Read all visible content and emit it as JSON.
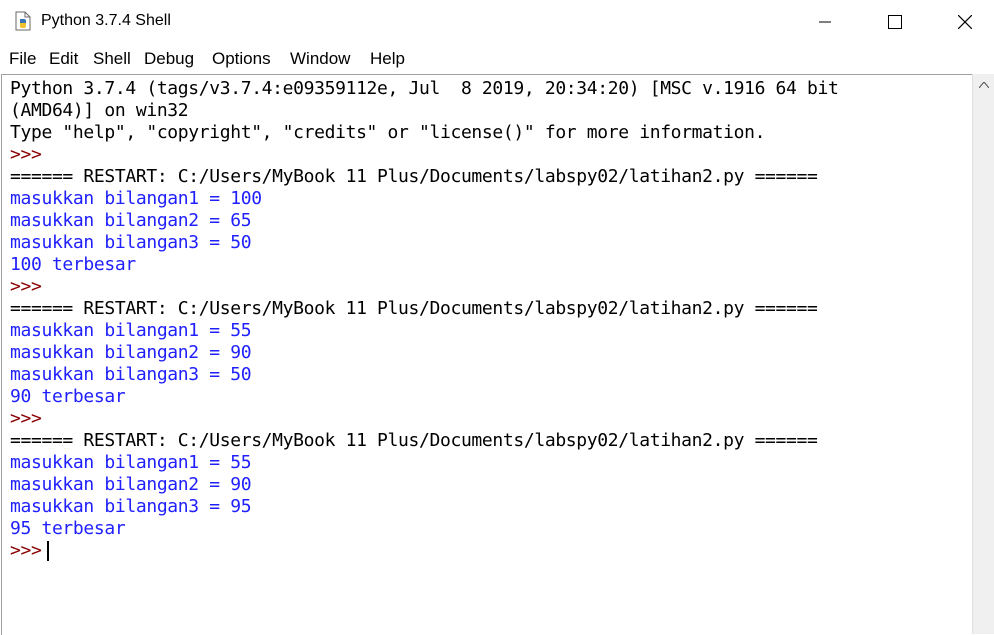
{
  "window": {
    "title": "Python 3.7.4 Shell"
  },
  "menu": [
    "File",
    "Edit",
    "Shell",
    "Debug",
    "Options",
    "Window",
    "Help"
  ],
  "shell": {
    "lines": [
      {
        "kind": "stdout",
        "text": "Python 3.7.4 (tags/v3.7.4:e09359112e, Jul  8 2019, 20:34:20) [MSC v.1916 64 bit"
      },
      {
        "kind": "stdout",
        "text": "(AMD64)] on win32"
      },
      {
        "kind": "stdout",
        "text": "Type \"help\", \"copyright\", \"credits\" or \"license()\" for more information."
      },
      {
        "kind": "prompt",
        "text": ">>>"
      },
      {
        "kind": "restart",
        "text": "====== RESTART: C:/Users/MyBook 11 Plus/Documents/labspy02/latihan2.py ======"
      },
      {
        "kind": "output",
        "text": "masukkan bilangan1 = 100"
      },
      {
        "kind": "output",
        "text": "masukkan bilangan2 = 65"
      },
      {
        "kind": "output",
        "text": "masukkan bilangan3 = 50"
      },
      {
        "kind": "output",
        "text": "100 terbesar"
      },
      {
        "kind": "prompt",
        "text": ">>>"
      },
      {
        "kind": "restart",
        "text": "====== RESTART: C:/Users/MyBook 11 Plus/Documents/labspy02/latihan2.py ======"
      },
      {
        "kind": "output",
        "text": "masukkan bilangan1 = 55"
      },
      {
        "kind": "output",
        "text": "masukkan bilangan2 = 90"
      },
      {
        "kind": "output",
        "text": "masukkan bilangan3 = 50"
      },
      {
        "kind": "output",
        "text": "90 terbesar"
      },
      {
        "kind": "prompt",
        "text": ">>>"
      },
      {
        "kind": "restart",
        "text": "====== RESTART: C:/Users/MyBook 11 Plus/Documents/labspy02/latihan2.py ======"
      },
      {
        "kind": "output",
        "text": "masukkan bilangan1 = 55"
      },
      {
        "kind": "output",
        "text": "masukkan bilangan2 = 90"
      },
      {
        "kind": "output",
        "text": "masukkan bilangan3 = 95"
      },
      {
        "kind": "output",
        "text": "95 terbesar"
      }
    ],
    "current_prompt": ">>>"
  },
  "colors": {
    "prompt": "#8b0000",
    "stdout": "#000000",
    "input": "#2020ff"
  },
  "icons": [
    "python-file-icon",
    "minimize-icon",
    "maximize-icon",
    "close-icon",
    "scroll-up-arrow-icon"
  ]
}
